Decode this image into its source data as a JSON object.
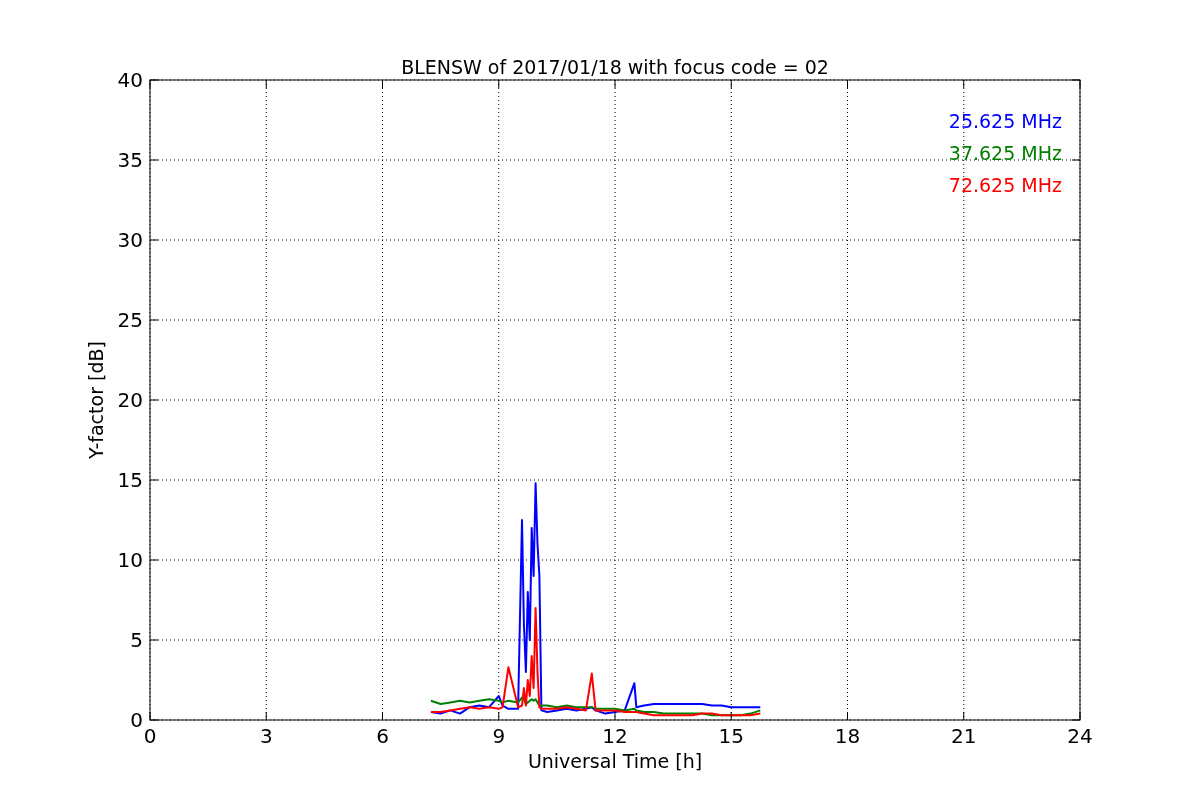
{
  "figure": {
    "chart_data": {
      "type": "line",
      "title": "BLENSW of 2017/01/18 with focus code = 02",
      "xlabel": "Universal Time [h]",
      "ylabel": "Y-factor [dB]",
      "x": [
        7.25,
        7.5,
        7.75,
        8,
        8.25,
        8.5,
        8.75,
        9,
        9.1,
        9.25,
        9.5,
        9.6,
        9.65,
        9.7,
        9.75,
        9.8,
        9.85,
        9.9,
        9.95,
        10,
        10.05,
        10.1,
        10.25,
        10.5,
        10.75,
        11,
        11.25,
        11.4,
        11.5,
        11.75,
        12,
        12.25,
        12.5,
        12.55,
        12.75,
        13,
        13.25,
        13.5,
        13.75,
        14,
        14.25,
        14.5,
        14.75,
        15,
        15.25,
        15.5,
        15.75
      ],
      "series": [
        {
          "name": "25.625 MHz",
          "color": "#0000ff",
          "values": [
            0.5,
            0.4,
            0.6,
            0.4,
            0.8,
            0.9,
            0.8,
            1.5,
            0.9,
            0.7,
            0.7,
            12.5,
            6,
            3,
            8,
            5,
            12,
            9,
            14.8,
            11,
            9,
            0.6,
            0.5,
            0.6,
            0.7,
            0.6,
            0.7,
            0.8,
            0.6,
            0.4,
            0.5,
            0.6,
            2.3,
            0.8,
            0.9,
            1.0,
            1.0,
            1.0,
            1.0,
            1.0,
            1.0,
            0.9,
            0.9,
            0.8,
            0.8,
            0.8,
            0.8
          ]
        },
        {
          "name": "37.625 MHz",
          "color": "#008000",
          "values": [
            1.2,
            1.0,
            1.1,
            1.2,
            1.1,
            1.2,
            1.3,
            1.2,
            1.1,
            1.2,
            1.1,
            1.4,
            1.3,
            1.0,
            1.1,
            1.2,
            1.3,
            1.2,
            1.3,
            1.1,
            0.9,
            0.9,
            0.9,
            0.8,
            0.9,
            0.8,
            0.8,
            0.8,
            0.7,
            0.7,
            0.7,
            0.6,
            0.7,
            0.6,
            0.5,
            0.5,
            0.4,
            0.4,
            0.4,
            0.4,
            0.4,
            0.3,
            0.3,
            0.3,
            0.3,
            0.4,
            0.6
          ]
        },
        {
          "name": "72.625 MHz",
          "color": "#ff0000",
          "values": [
            0.5,
            0.5,
            0.6,
            0.7,
            0.8,
            0.7,
            0.8,
            0.7,
            0.8,
            3.3,
            0.8,
            0.9,
            2,
            0.9,
            2.5,
            1.5,
            4,
            2,
            7,
            3,
            0.8,
            0.7,
            0.7,
            0.7,
            0.8,
            0.7,
            0.6,
            2.9,
            0.6,
            0.6,
            0.6,
            0.5,
            0.5,
            0.5,
            0.4,
            0.3,
            0.3,
            0.3,
            0.3,
            0.3,
            0.4,
            0.4,
            0.3,
            0.3,
            0.3,
            0.3,
            0.4
          ]
        }
      ],
      "grid": true,
      "xlim": [
        0,
        24
      ],
      "ylim": [
        0,
        40
      ],
      "xticks": [
        0,
        3,
        6,
        9,
        12,
        15,
        18,
        21,
        24
      ],
      "yticks": [
        0,
        5,
        10,
        15,
        20,
        25,
        30,
        35,
        40
      ]
    }
  }
}
